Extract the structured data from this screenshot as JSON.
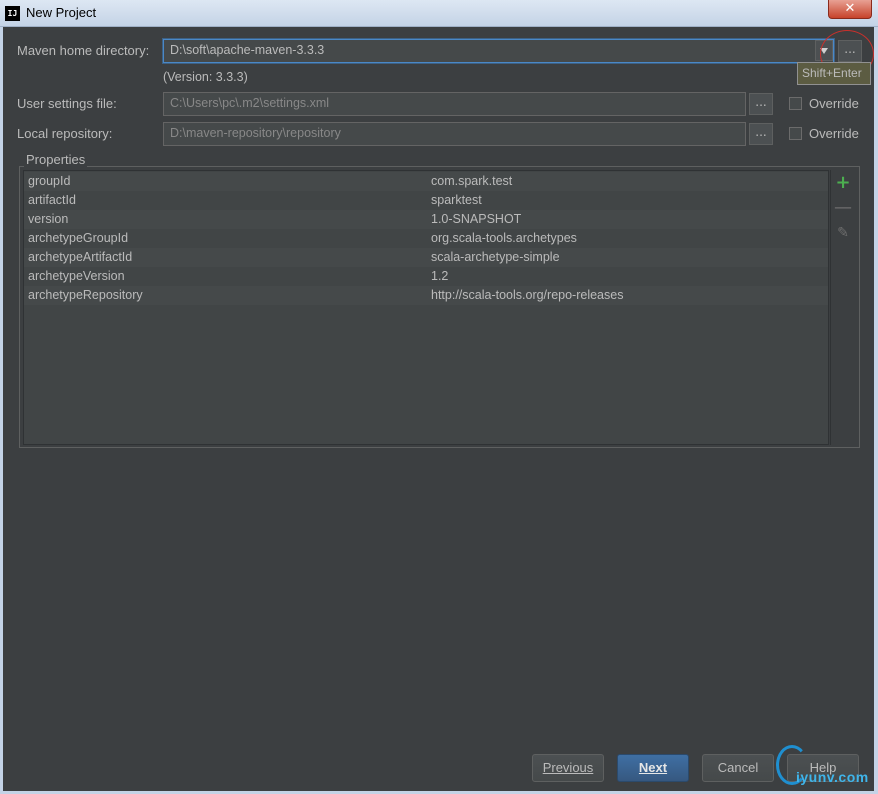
{
  "window": {
    "title": "New Project",
    "icon_text": "IJ",
    "close_glyph": "✕"
  },
  "maven_home": {
    "label": "Maven home directory:",
    "value": "D:\\soft\\apache-maven-3.3.3",
    "version_text": "(Version: 3.3.3)",
    "browse_label": "...",
    "tooltip": "Shift+Enter"
  },
  "user_settings": {
    "label": "User settings file:",
    "value": "C:\\Users\\pc\\.m2\\settings.xml",
    "browse_label": "...",
    "override_label": "Override",
    "override_checked": false
  },
  "local_repo": {
    "label": "Local repository:",
    "value": "D:\\maven-repository\\repository",
    "browse_label": "...",
    "override_label": "Override",
    "override_checked": false
  },
  "properties": {
    "title": "Properties",
    "rows": [
      {
        "key": "groupId",
        "value": "com.spark.test"
      },
      {
        "key": "artifactId",
        "value": "sparktest"
      },
      {
        "key": "version",
        "value": "1.0-SNAPSHOT"
      },
      {
        "key": "archetypeGroupId",
        "value": "org.scala-tools.archetypes"
      },
      {
        "key": "archetypeArtifactId",
        "value": "scala-archetype-simple"
      },
      {
        "key": "archetypeVersion",
        "value": "1.2"
      },
      {
        "key": "archetypeRepository",
        "value": "http://scala-tools.org/repo-releases"
      }
    ],
    "tools": {
      "add": "+",
      "remove": "—",
      "edit": "✎"
    }
  },
  "footer": {
    "previous": "Previous",
    "next": "Next",
    "cancel": "Cancel",
    "help": "Help"
  },
  "watermark": "iyunv.com"
}
